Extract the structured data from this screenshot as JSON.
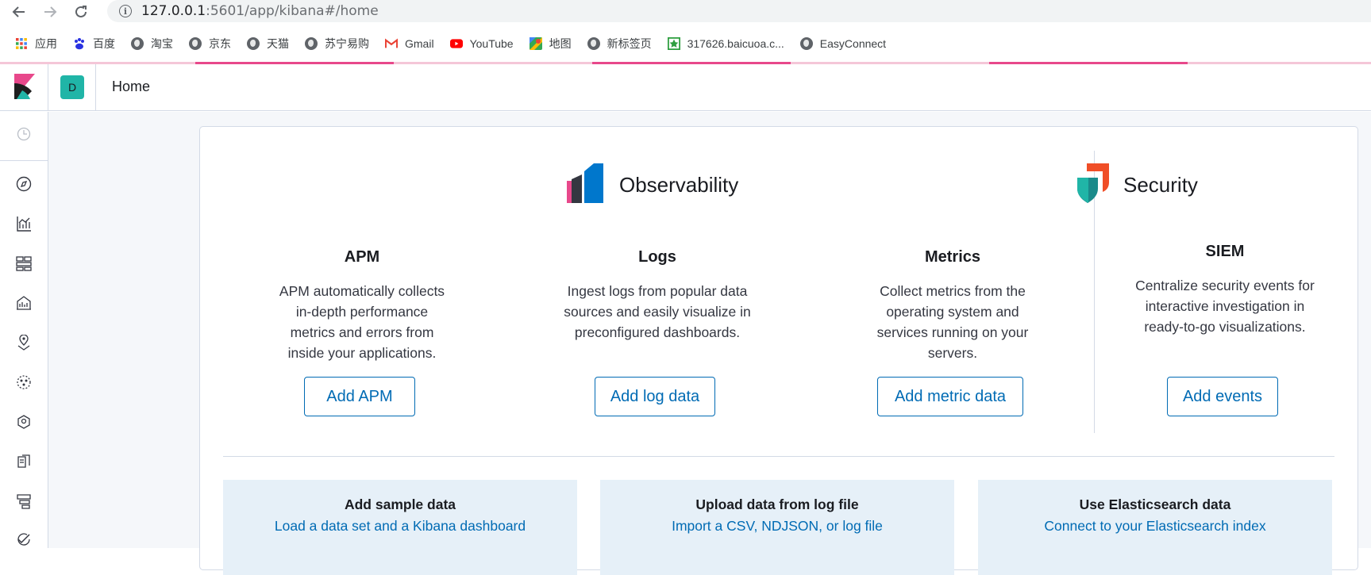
{
  "browser": {
    "url_host": "127.0.0.1",
    "url_rest": ":5601/app/kibana#/home",
    "bookmarks": [
      {
        "label": "应用",
        "icon": "apps-grid-icon"
      },
      {
        "label": "百度",
        "icon": "baidu-icon"
      },
      {
        "label": "淘宝",
        "icon": "globe-icon"
      },
      {
        "label": "京东",
        "icon": "globe-icon"
      },
      {
        "label": "天猫",
        "icon": "globe-icon"
      },
      {
        "label": "苏宁易购",
        "icon": "globe-icon"
      },
      {
        "label": "Gmail",
        "icon": "gmail-icon"
      },
      {
        "label": "YouTube",
        "icon": "youtube-icon"
      },
      {
        "label": "地图",
        "icon": "maps-icon"
      },
      {
        "label": "新标签页",
        "icon": "globe-icon"
      },
      {
        "label": "317626.baicuoa.c...",
        "icon": "baicuoa-icon"
      },
      {
        "label": "EasyConnect",
        "icon": "globe-icon"
      }
    ]
  },
  "header": {
    "space_initial": "D",
    "breadcrumb": "Home"
  },
  "sidenav": {
    "items": [
      "clock-icon",
      "discover-icon",
      "visualize-icon",
      "dashboard-icon",
      "canvas-icon",
      "maps-icon",
      "ml-icon",
      "metrics-icon",
      "logs-icon",
      "apm-icon",
      "uptime-icon"
    ]
  },
  "observability": {
    "title": "Observability",
    "features": [
      {
        "title": "APM",
        "description": "APM automatically collects in-depth performance metrics and errors from inside your applications.",
        "button": "Add APM"
      },
      {
        "title": "Logs",
        "description": "Ingest logs from popular data sources and easily visualize in preconfigured dashboards.",
        "button": "Add log data"
      },
      {
        "title": "Metrics",
        "description": "Collect metrics from the operating system and services running on your servers.",
        "button": "Add metric data"
      }
    ]
  },
  "security": {
    "title": "Security",
    "feature": {
      "title": "SIEM",
      "description": "Centralize security events for interactive investigation in ready-to-go visualizations.",
      "button": "Add events"
    }
  },
  "tiles": [
    {
      "title": "Add sample data",
      "subtitle": "Load a data set and a Kibana dashboard"
    },
    {
      "title": "Upload data from log file",
      "subtitle": "Import a CSV, NDJSON, or log file"
    },
    {
      "title": "Use Elasticsearch data",
      "subtitle": "Connect to your Elasticsearch index"
    }
  ],
  "colors": {
    "accent": "#006bb4",
    "kibana_pink": "#e8488b",
    "teal": "#20b5a7"
  }
}
